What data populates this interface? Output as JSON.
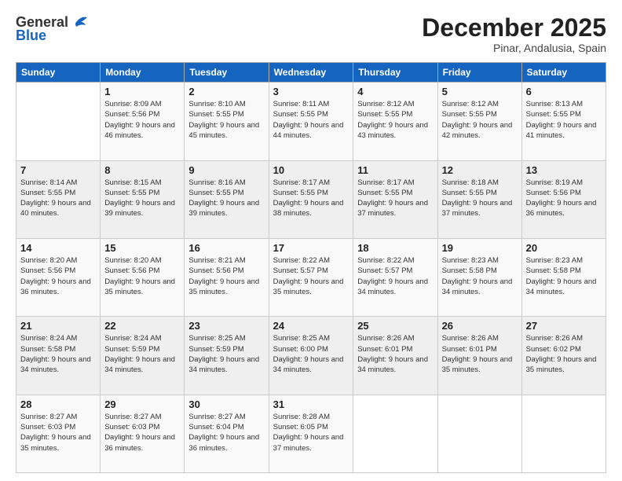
{
  "header": {
    "logo_general": "General",
    "logo_blue": "Blue",
    "month": "December 2025",
    "location": "Pinar, Andalusia, Spain"
  },
  "days_of_week": [
    "Sunday",
    "Monday",
    "Tuesday",
    "Wednesday",
    "Thursday",
    "Friday",
    "Saturday"
  ],
  "weeks": [
    [
      {
        "day": "",
        "sunrise": "",
        "sunset": "",
        "daylight": ""
      },
      {
        "day": "1",
        "sunrise": "Sunrise: 8:09 AM",
        "sunset": "Sunset: 5:56 PM",
        "daylight": "Daylight: 9 hours and 46 minutes."
      },
      {
        "day": "2",
        "sunrise": "Sunrise: 8:10 AM",
        "sunset": "Sunset: 5:55 PM",
        "daylight": "Daylight: 9 hours and 45 minutes."
      },
      {
        "day": "3",
        "sunrise": "Sunrise: 8:11 AM",
        "sunset": "Sunset: 5:55 PM",
        "daylight": "Daylight: 9 hours and 44 minutes."
      },
      {
        "day": "4",
        "sunrise": "Sunrise: 8:12 AM",
        "sunset": "Sunset: 5:55 PM",
        "daylight": "Daylight: 9 hours and 43 minutes."
      },
      {
        "day": "5",
        "sunrise": "Sunrise: 8:12 AM",
        "sunset": "Sunset: 5:55 PM",
        "daylight": "Daylight: 9 hours and 42 minutes."
      },
      {
        "day": "6",
        "sunrise": "Sunrise: 8:13 AM",
        "sunset": "Sunset: 5:55 PM",
        "daylight": "Daylight: 9 hours and 41 minutes."
      }
    ],
    [
      {
        "day": "7",
        "sunrise": "Sunrise: 8:14 AM",
        "sunset": "Sunset: 5:55 PM",
        "daylight": "Daylight: 9 hours and 40 minutes."
      },
      {
        "day": "8",
        "sunrise": "Sunrise: 8:15 AM",
        "sunset": "Sunset: 5:55 PM",
        "daylight": "Daylight: 9 hours and 39 minutes."
      },
      {
        "day": "9",
        "sunrise": "Sunrise: 8:16 AM",
        "sunset": "Sunset: 5:55 PM",
        "daylight": "Daylight: 9 hours and 39 minutes."
      },
      {
        "day": "10",
        "sunrise": "Sunrise: 8:17 AM",
        "sunset": "Sunset: 5:55 PM",
        "daylight": "Daylight: 9 hours and 38 minutes."
      },
      {
        "day": "11",
        "sunrise": "Sunrise: 8:17 AM",
        "sunset": "Sunset: 5:55 PM",
        "daylight": "Daylight: 9 hours and 37 minutes."
      },
      {
        "day": "12",
        "sunrise": "Sunrise: 8:18 AM",
        "sunset": "Sunset: 5:55 PM",
        "daylight": "Daylight: 9 hours and 37 minutes."
      },
      {
        "day": "13",
        "sunrise": "Sunrise: 8:19 AM",
        "sunset": "Sunset: 5:56 PM",
        "daylight": "Daylight: 9 hours and 36 minutes."
      }
    ],
    [
      {
        "day": "14",
        "sunrise": "Sunrise: 8:20 AM",
        "sunset": "Sunset: 5:56 PM",
        "daylight": "Daylight: 9 hours and 36 minutes."
      },
      {
        "day": "15",
        "sunrise": "Sunrise: 8:20 AM",
        "sunset": "Sunset: 5:56 PM",
        "daylight": "Daylight: 9 hours and 35 minutes."
      },
      {
        "day": "16",
        "sunrise": "Sunrise: 8:21 AM",
        "sunset": "Sunset: 5:56 PM",
        "daylight": "Daylight: 9 hours and 35 minutes."
      },
      {
        "day": "17",
        "sunrise": "Sunrise: 8:22 AM",
        "sunset": "Sunset: 5:57 PM",
        "daylight": "Daylight: 9 hours and 35 minutes."
      },
      {
        "day": "18",
        "sunrise": "Sunrise: 8:22 AM",
        "sunset": "Sunset: 5:57 PM",
        "daylight": "Daylight: 9 hours and 34 minutes."
      },
      {
        "day": "19",
        "sunrise": "Sunrise: 8:23 AM",
        "sunset": "Sunset: 5:58 PM",
        "daylight": "Daylight: 9 hours and 34 minutes."
      },
      {
        "day": "20",
        "sunrise": "Sunrise: 8:23 AM",
        "sunset": "Sunset: 5:58 PM",
        "daylight": "Daylight: 9 hours and 34 minutes."
      }
    ],
    [
      {
        "day": "21",
        "sunrise": "Sunrise: 8:24 AM",
        "sunset": "Sunset: 5:58 PM",
        "daylight": "Daylight: 9 hours and 34 minutes."
      },
      {
        "day": "22",
        "sunrise": "Sunrise: 8:24 AM",
        "sunset": "Sunset: 5:59 PM",
        "daylight": "Daylight: 9 hours and 34 minutes."
      },
      {
        "day": "23",
        "sunrise": "Sunrise: 8:25 AM",
        "sunset": "Sunset: 5:59 PM",
        "daylight": "Daylight: 9 hours and 34 minutes."
      },
      {
        "day": "24",
        "sunrise": "Sunrise: 8:25 AM",
        "sunset": "Sunset: 6:00 PM",
        "daylight": "Daylight: 9 hours and 34 minutes."
      },
      {
        "day": "25",
        "sunrise": "Sunrise: 8:26 AM",
        "sunset": "Sunset: 6:01 PM",
        "daylight": "Daylight: 9 hours and 34 minutes."
      },
      {
        "day": "26",
        "sunrise": "Sunrise: 8:26 AM",
        "sunset": "Sunset: 6:01 PM",
        "daylight": "Daylight: 9 hours and 35 minutes."
      },
      {
        "day": "27",
        "sunrise": "Sunrise: 8:26 AM",
        "sunset": "Sunset: 6:02 PM",
        "daylight": "Daylight: 9 hours and 35 minutes."
      }
    ],
    [
      {
        "day": "28",
        "sunrise": "Sunrise: 8:27 AM",
        "sunset": "Sunset: 6:03 PM",
        "daylight": "Daylight: 9 hours and 35 minutes."
      },
      {
        "day": "29",
        "sunrise": "Sunrise: 8:27 AM",
        "sunset": "Sunset: 6:03 PM",
        "daylight": "Daylight: 9 hours and 36 minutes."
      },
      {
        "day": "30",
        "sunrise": "Sunrise: 8:27 AM",
        "sunset": "Sunset: 6:04 PM",
        "daylight": "Daylight: 9 hours and 36 minutes."
      },
      {
        "day": "31",
        "sunrise": "Sunrise: 8:28 AM",
        "sunset": "Sunset: 6:05 PM",
        "daylight": "Daylight: 9 hours and 37 minutes."
      },
      {
        "day": "",
        "sunrise": "",
        "sunset": "",
        "daylight": ""
      },
      {
        "day": "",
        "sunrise": "",
        "sunset": "",
        "daylight": ""
      },
      {
        "day": "",
        "sunrise": "",
        "sunset": "",
        "daylight": ""
      }
    ]
  ]
}
